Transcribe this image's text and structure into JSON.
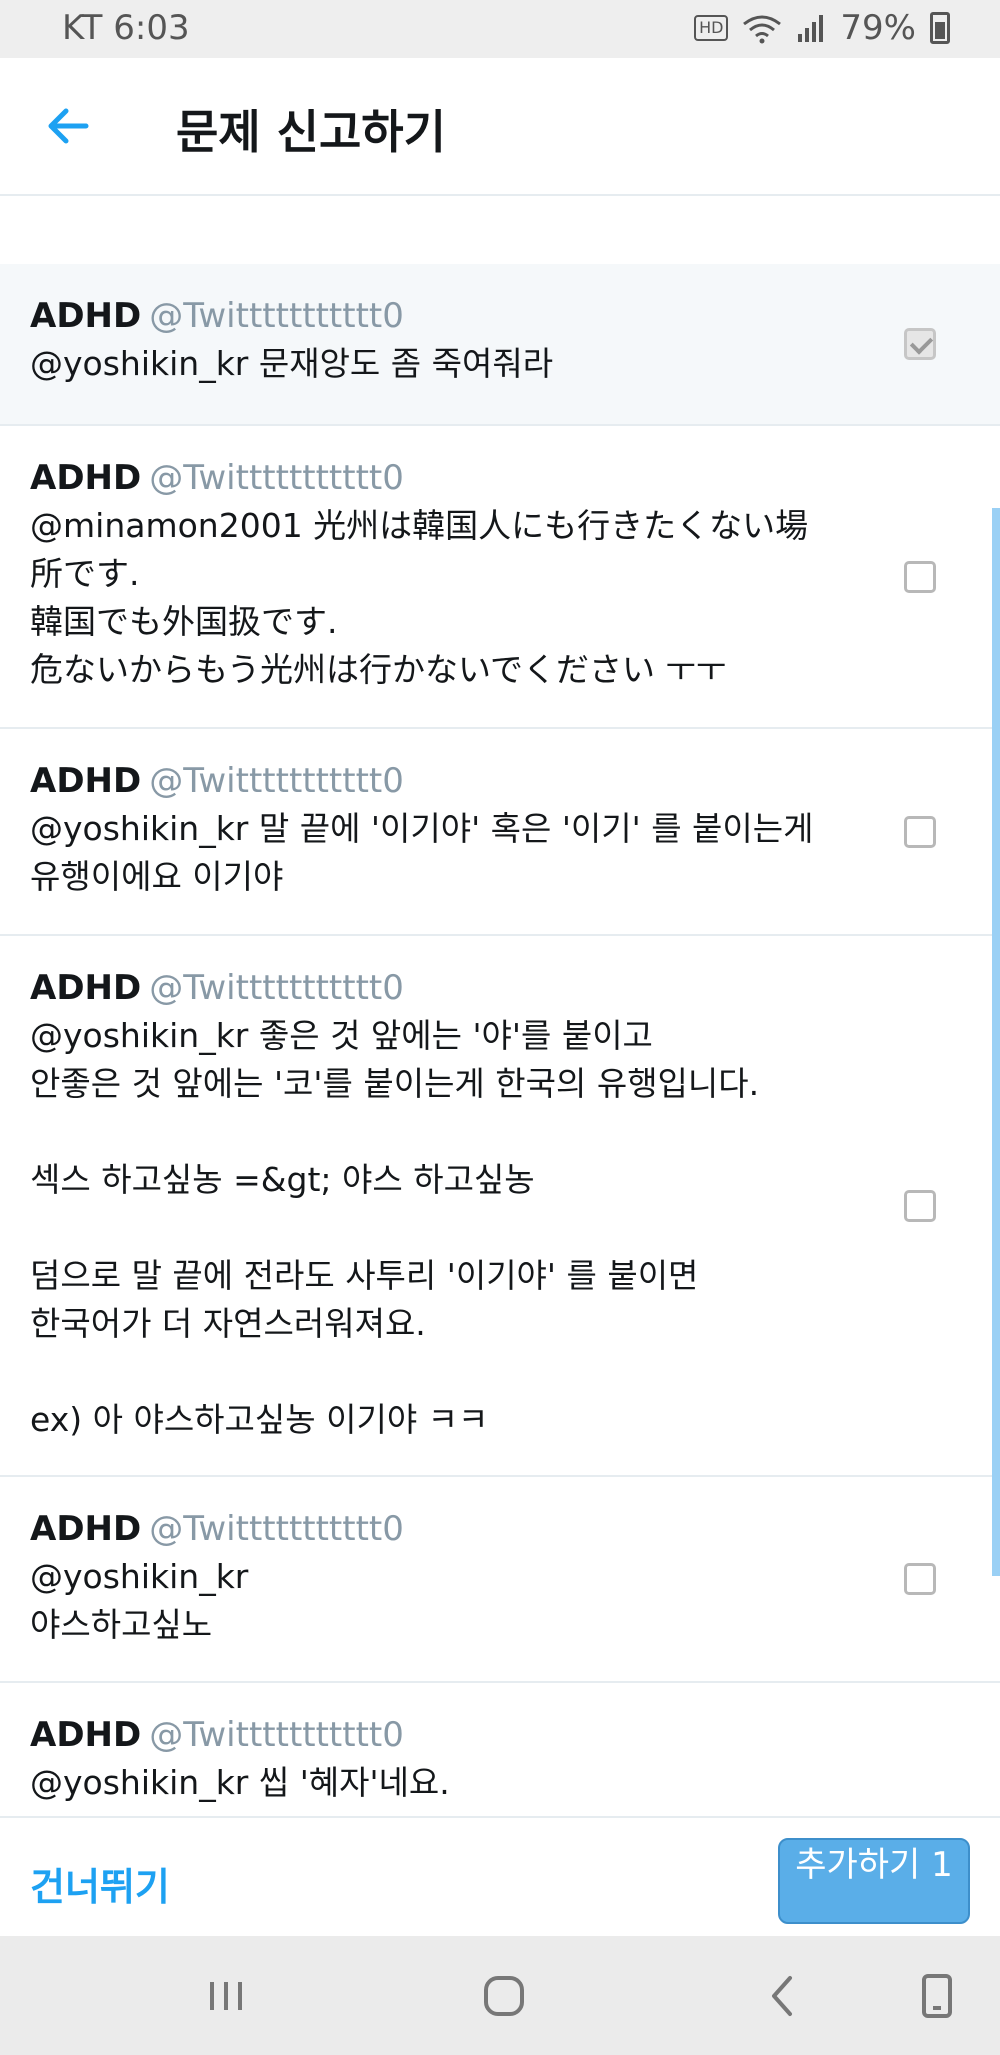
{
  "status_bar": {
    "carrier_time": "KT 6:03",
    "hd": "HD",
    "battery": "79%"
  },
  "header": {
    "title": "문제 신고하기",
    "back_icon": "arrow-left-icon"
  },
  "tweets": [
    {
      "author": "ADHD",
      "handle": "@Twittttttttttt0",
      "text": "@yoshikin_kr 문재앙도 좀 죽여줘라",
      "checked": true
    },
    {
      "author": "ADHD",
      "handle": "@Twittttttttttt0",
      "text": "@minamon2001 光州は韓国人にも行きたくない場\n所です.\n韓国でも外国扱です.\n危ないからもう光州は行かないでください ㅜㅜ",
      "checked": false
    },
    {
      "author": "ADHD",
      "handle": "@Twittttttttttt0",
      "text": "@yoshikin_kr 말 끝에 '이기야' 혹은 '이기' 를 붙이는게\n유행이에요 이기야",
      "checked": false
    },
    {
      "author": "ADHD",
      "handle": "@Twittttttttttt0",
      "text": "@yoshikin_kr 좋은 것 앞에는 '야'를 붙이고\n안좋은 것 앞에는 '코'를 붙이는게 한국의 유행입니다.\n\n섹스 하고싶농 =&gt; 야스 하고싶농\n\n덤으로 말 끝에 전라도 사투리 '이기야' 를 붙이면\n한국어가 더 자연스러워져요.\n\nex) 아 야스하고싶농 이기야 ㅋㅋ",
      "checked": false
    },
    {
      "author": "ADHD",
      "handle": "@Twittttttttttt0",
      "text": "@yoshikin_kr\n야스하고싶노",
      "checked": false
    },
    {
      "author": "ADHD",
      "handle": "@Twittttttttttt0",
      "text": "@yoshikin_kr 씹 '혜자'네요.",
      "checked": false
    }
  ],
  "actions": {
    "skip": "건너뛰기",
    "add": "추가하기 1"
  },
  "colors": {
    "accent": "#1da1f2",
    "button": "#5aaee8",
    "handle": "#8899a6"
  }
}
